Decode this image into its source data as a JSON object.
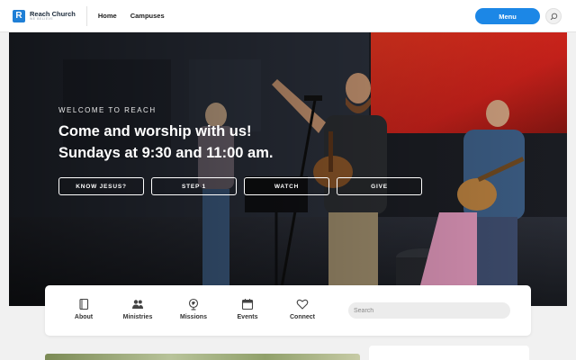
{
  "header": {
    "brand": "Reach Church",
    "brand_sub": "WE BELIEVE",
    "logo_letter": "R",
    "nav": [
      "Home",
      "Campuses"
    ],
    "menu_label": "Menu",
    "search_icon": "search-icon"
  },
  "hero": {
    "eyebrow": "WELCOME TO REACH",
    "line1": "Come and worship with us!",
    "line2": "Sundays at 9:30 and 11:00 am.",
    "buttons": [
      "KNOW JESUS?",
      "STEP 1",
      "WATCH",
      "GIVE"
    ]
  },
  "quick_links": {
    "items": [
      {
        "label": "About",
        "icon": "book-icon"
      },
      {
        "label": "Ministries",
        "icon": "people-icon"
      },
      {
        "label": "Missions",
        "icon": "globe-icon"
      },
      {
        "label": "Events",
        "icon": "calendar-icon"
      },
      {
        "label": "Connect",
        "icon": "heart-icon"
      }
    ],
    "search_placeholder": "Search"
  },
  "colors": {
    "accent": "#1c87e6",
    "led_wall": "#d9271d"
  }
}
